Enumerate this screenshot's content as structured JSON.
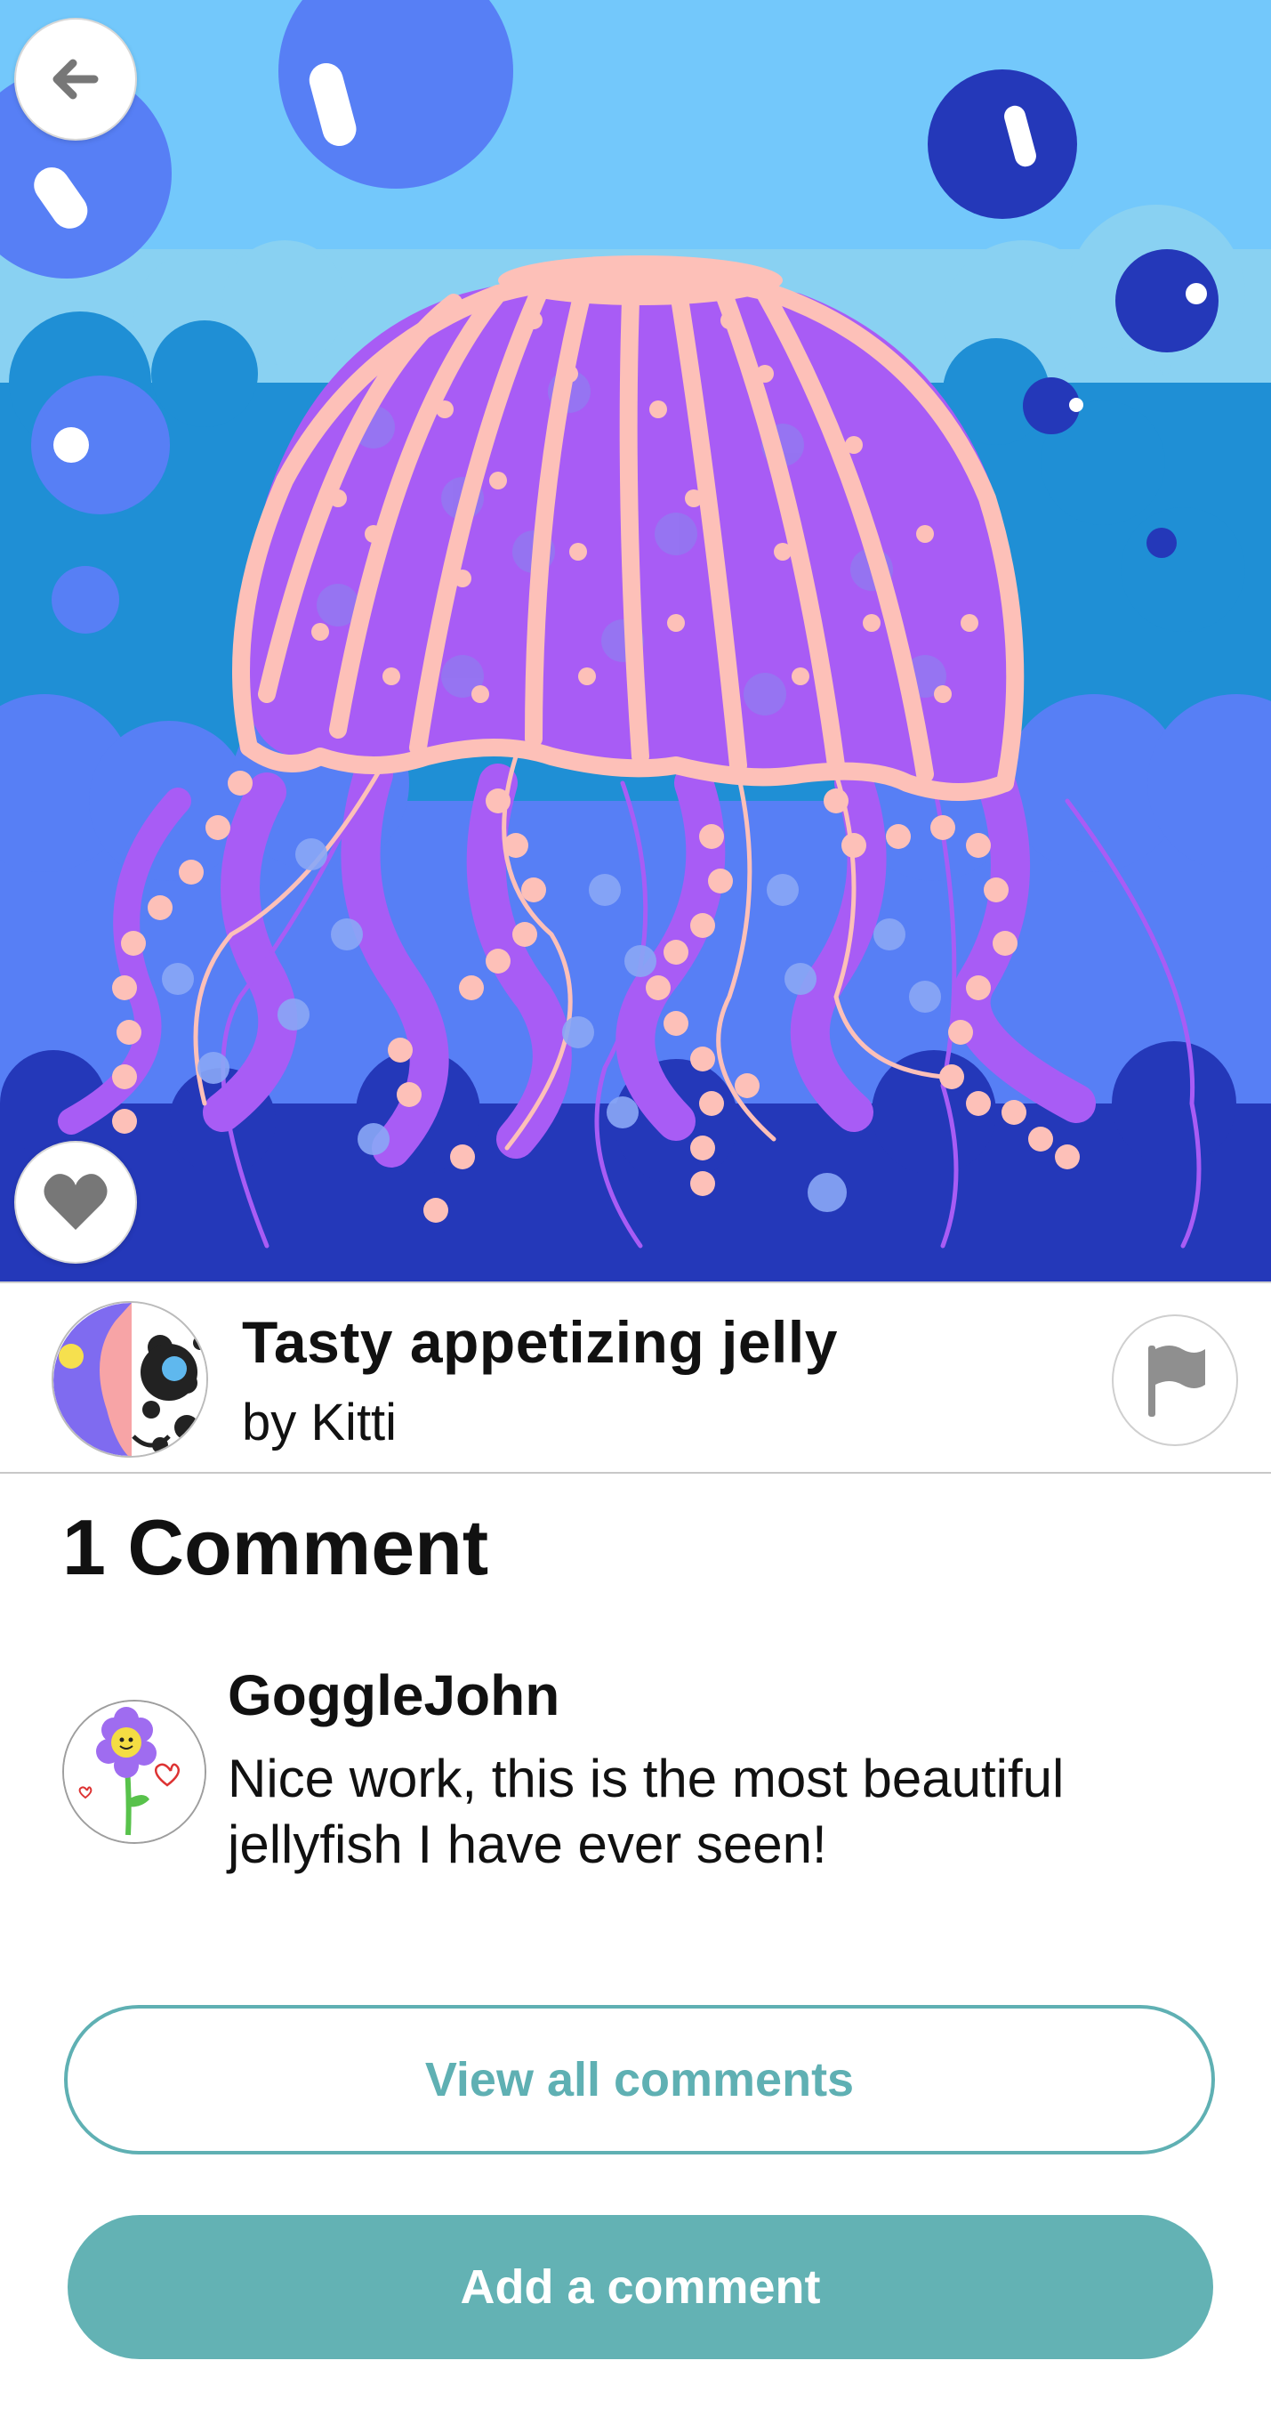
{
  "artwork": {
    "title": "Tasty appetizing jelly",
    "byline": "by Kitti",
    "colors": {
      "sky": "#73c8fb",
      "cloud": "#89d1f2",
      "water_mid": "#1f8fd5",
      "water_deep": "#577ff5",
      "seabed": "#2438b9",
      "jelly_body": "#a85cf5",
      "jelly_outline": "#fdc0b8"
    }
  },
  "toolbar": {
    "back_icon": "arrow-left-icon",
    "like_icon": "heart-icon",
    "report_icon": "flag-icon"
  },
  "comments": {
    "heading": "1 Comment",
    "items": [
      {
        "author": "GoggleJohn",
        "text": "Nice work, this is the most beautiful jellyfish I have ever seen!"
      }
    ]
  },
  "actions": {
    "view_all_label": "View all comments",
    "add_comment_label": "Add a comment",
    "accent_color": "#63b2b4"
  }
}
